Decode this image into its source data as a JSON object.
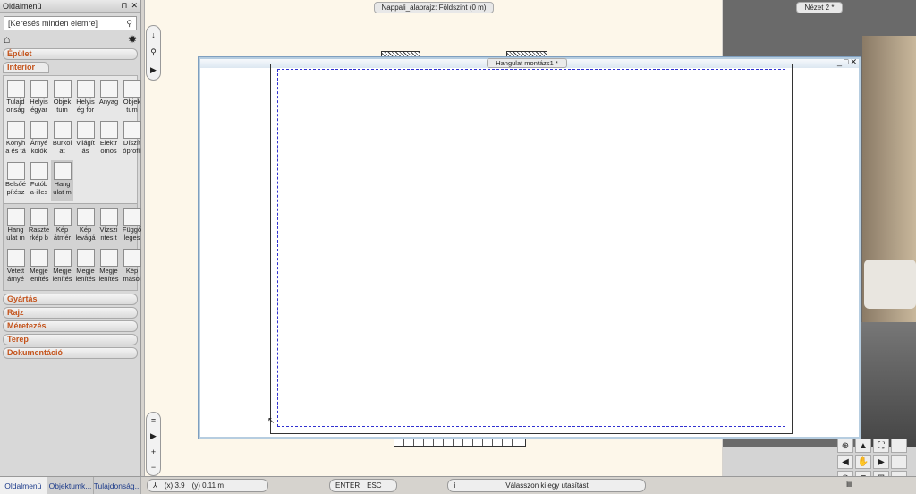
{
  "sidebar": {
    "title": "Oldalmenü",
    "search_placeholder": "[Keresés minden elemre]",
    "categories": {
      "epulet": "Épület",
      "interior": "Interior",
      "gyartas": "Gyártás",
      "rajz": "Rajz",
      "meretezes": "Méretezés",
      "terep": "Terep",
      "dokumentacio": "Dokumentáció"
    },
    "tools": [
      "Tulajd\nonság",
      "Helyis\négyar",
      "Objek\ntum",
      "Helyis\nég for",
      "Anyag",
      "Objek\ntum",
      "Konyh\na és tá",
      "Árnyé\nkolók",
      "Burkol\nat",
      "Világít\nás",
      "Elektr\nomos",
      "Díszít\nóprofil",
      "Belsőé\npítész",
      "Fotób\na-illes",
      "Hang\nulat m"
    ],
    "subtools": [
      "Hang\nulat m",
      "Raszte\nrkép b",
      "Kép\nátmér",
      "Kép\nlevágá",
      "Vízszi\nntes t",
      "Függő\nleges",
      "Vetett\nárnyé",
      "Megje\nlenítés",
      "Megje\nlenítés",
      "Megje\nlenítés",
      "Megje\nlenítés",
      "Kép\nmásol"
    ],
    "tabs": [
      "Oldalmenü",
      "Objektumk...",
      "Tulajdonság..."
    ]
  },
  "plan": {
    "title": "Nappali_alaprajz: Földszint (0 m)"
  },
  "view3d": {
    "title": "Nézet 2 *"
  },
  "floating": {
    "title": "Hangulat montázs1 *"
  },
  "status": {
    "x_label": "(x) 3.9",
    "y_label": "(y) 0.11 m",
    "enter": "ENTER",
    "esc": "ESC",
    "message": "Válasszon ki egy utasítást"
  },
  "colors": {
    "category_text": "#c4531b",
    "margin_line": "#3030d0",
    "plan_bg": "#fdf7ea"
  }
}
